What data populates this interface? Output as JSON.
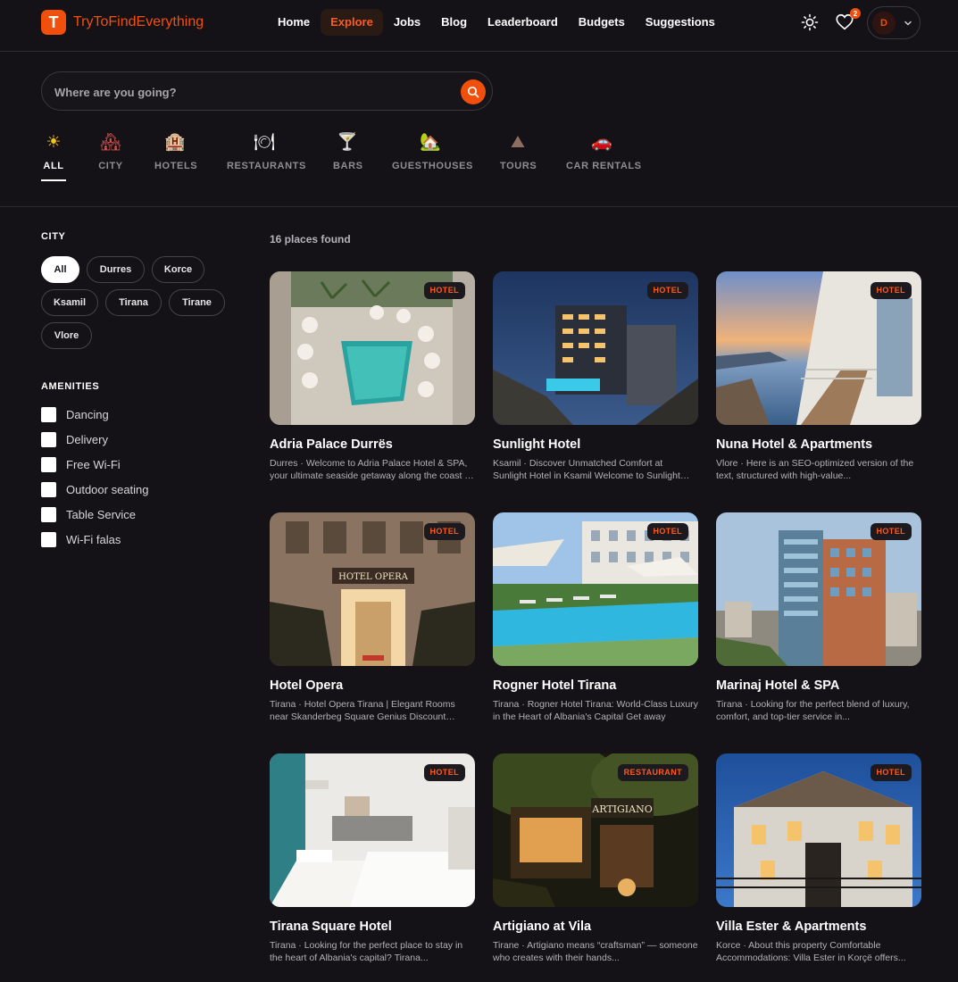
{
  "brand": {
    "logo_letter": "T",
    "name": "TryToFindEverything",
    "accent": "#f0500c"
  },
  "nav": [
    {
      "label": "Home",
      "active": false
    },
    {
      "label": "Explore",
      "active": true
    },
    {
      "label": "Jobs",
      "active": false
    },
    {
      "label": "Blog",
      "active": false
    },
    {
      "label": "Leaderboard",
      "active": false
    },
    {
      "label": "Budgets",
      "active": false
    },
    {
      "label": "Suggestions",
      "active": false
    }
  ],
  "header": {
    "favorites_count": "2",
    "avatar_initial": "D"
  },
  "search": {
    "placeholder": "Where are you going?",
    "value": ""
  },
  "categories": [
    {
      "label": "ALL",
      "icon": "sun-icon",
      "glyph": "☀",
      "active": true
    },
    {
      "label": "CITY",
      "icon": "city-icon",
      "glyph": "🏘",
      "active": false
    },
    {
      "label": "HOTELS",
      "icon": "hotel-icon",
      "glyph": "🏨",
      "active": false
    },
    {
      "label": "RESTAURANTS",
      "icon": "restaurant-icon",
      "glyph": "🍽",
      "active": false
    },
    {
      "label": "BARS",
      "icon": "cocktail-icon",
      "glyph": "🍸",
      "active": false
    },
    {
      "label": "GUESTHOUSES",
      "icon": "house-icon",
      "glyph": "🏡",
      "active": false
    },
    {
      "label": "TOURS",
      "icon": "mountain-icon",
      "glyph": "⛰",
      "active": false
    },
    {
      "label": "CAR RENTALS",
      "icon": "car-icon",
      "glyph": "🚗",
      "active": false
    }
  ],
  "filters": {
    "city_title": "CITY",
    "cities": [
      {
        "label": "All",
        "active": true
      },
      {
        "label": "Durres",
        "active": false
      },
      {
        "label": "Korce",
        "active": false
      },
      {
        "label": "Ksamil",
        "active": false
      },
      {
        "label": "Tirana",
        "active": false
      },
      {
        "label": "Tirane",
        "active": false
      },
      {
        "label": "Vlore",
        "active": false
      }
    ],
    "amenities_title": "AMENITIES",
    "amenities": [
      {
        "label": "Dancing",
        "checked": false
      },
      {
        "label": "Delivery",
        "checked": false
      },
      {
        "label": "Free Wi-Fi",
        "checked": false
      },
      {
        "label": "Outdoor seating",
        "checked": false
      },
      {
        "label": "Table Service",
        "checked": false
      },
      {
        "label": "Wi-Fi falas",
        "checked": false
      }
    ]
  },
  "results": {
    "count_label": "16 places found",
    "places": [
      {
        "name": "Adria Palace Durrës",
        "category": "HOTEL",
        "description": "Durres · Welcome to Adria Palace Hotel & SPA, your ultimate seaside getaway along the coast of Durres",
        "image": "pool-aerial"
      },
      {
        "name": "Sunlight Hotel",
        "category": "HOTEL",
        "description": "Ksamil · Discover Unmatched Comfort at Sunlight Hotel in Ksamil Welcome to Sunlight Hotel",
        "image": "night-hotel"
      },
      {
        "name": "Nuna Hotel & Apartments",
        "category": "HOTEL",
        "description": "Vlore · Here is an SEO-optimized version of the text, structured with high-value...",
        "image": "sea-sunset"
      },
      {
        "name": "Hotel Opera",
        "category": "HOTEL",
        "description": "Tirana · Hotel Opera Tirana | Elegant Rooms near Skanderbeg Square Genius Discount available",
        "image": "hotel-entrance"
      },
      {
        "name": "Rogner Hotel Tirana",
        "category": "HOTEL",
        "description": "Tirana · Rogner Hotel Tirana: World-Class Luxury in the Heart of Albania's Capital Get away",
        "image": "garden-pool"
      },
      {
        "name": "Marinaj Hotel & SPA",
        "category": "HOTEL",
        "description": "Tirana · Looking for the perfect blend of luxury, comfort, and top-tier service in...",
        "image": "tower-hotel"
      },
      {
        "name": "Tirana Square Hotel",
        "category": "HOTEL",
        "description": "Tirana · Looking for the perfect place to stay in the heart of Albania's capital? Tirana...",
        "image": "hotel-room"
      },
      {
        "name": "Artigiano at Vila",
        "category": "RESTAURANT",
        "description": "Tirane · Artigiano means “craftsman” — someone who creates with their hands...",
        "image": "restaurant-night"
      },
      {
        "name": "Villa Ester & Apartments",
        "category": "HOTEL",
        "description": "Korce · About this property Comfortable Accommodations: Villa Ester in Korçë offers...",
        "image": "villa-dusk"
      }
    ]
  }
}
